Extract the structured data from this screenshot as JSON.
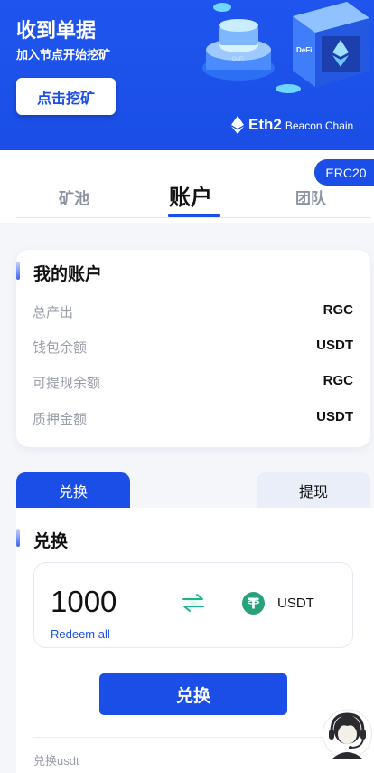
{
  "banner": {
    "title": "收到单据",
    "subtitle": "加入节点开始挖矿",
    "mine_button": "点击挖矿",
    "eth_name": "Eth2",
    "eth_chain": "Beacon Chain",
    "illus_text": "DeFi"
  },
  "tabs": {
    "badge": "ERC20",
    "items": [
      {
        "label": "矿池",
        "active": false
      },
      {
        "label": "账户",
        "active": true
      },
      {
        "label": "团队",
        "active": false
      }
    ]
  },
  "account": {
    "title": "我的账户",
    "rows": [
      {
        "label": "总产出",
        "value": "RGC"
      },
      {
        "label": "钱包余额",
        "value": "USDT"
      },
      {
        "label": "可提现余额",
        "value": "RGC"
      },
      {
        "label": "质押金额",
        "value": "USDT"
      }
    ]
  },
  "exchange": {
    "tab_active": "兑换",
    "tab_inactive": "提现",
    "title": "兑换",
    "amount": "1000",
    "redeem_all": "Redeem all",
    "currency": "USDT",
    "button": "兑换",
    "note": "兑换usdt"
  },
  "colors": {
    "primary": "#1a4ee6",
    "tether": "#26a17b"
  },
  "icons": [
    "ethereum-icon",
    "swap-icon",
    "usdt-icon",
    "customer-service-icon"
  ]
}
